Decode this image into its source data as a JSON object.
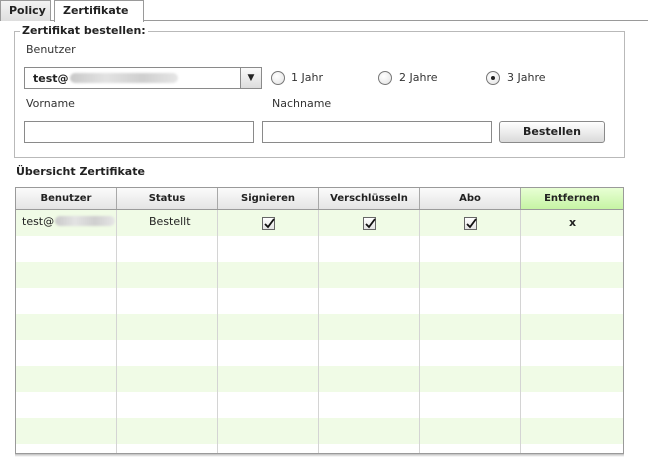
{
  "tabs": [
    {
      "label": "Policy",
      "active": false
    },
    {
      "label": "Zertifikate",
      "active": true
    }
  ],
  "order": {
    "legend": "Zertifikat bestellen:",
    "user_label": "Benutzer",
    "user_value_prefix": "test@",
    "validity_options": [
      {
        "label": "1 Jahr",
        "checked": false
      },
      {
        "label": "2 Jahre",
        "checked": false
      },
      {
        "label": "3 Jahre",
        "checked": true
      }
    ],
    "firstname_label": "Vorname",
    "firstname_value": "",
    "lastname_label": "Nachname",
    "lastname_value": "",
    "submit_label": "Bestellen"
  },
  "overview": {
    "title": "Übersicht Zertifikate",
    "columns": [
      "Benutzer",
      "Status",
      "Signieren",
      "Verschlüsseln",
      "Abo",
      "Entfernen"
    ],
    "rows": [
      {
        "user_prefix": "test@",
        "status": "Bestellt",
        "sign": true,
        "encrypt": true,
        "abo": true,
        "remove": "x"
      }
    ]
  },
  "colors": {
    "row_alt": "#f0fbe6",
    "header_highlight": "#c6f4a4"
  }
}
